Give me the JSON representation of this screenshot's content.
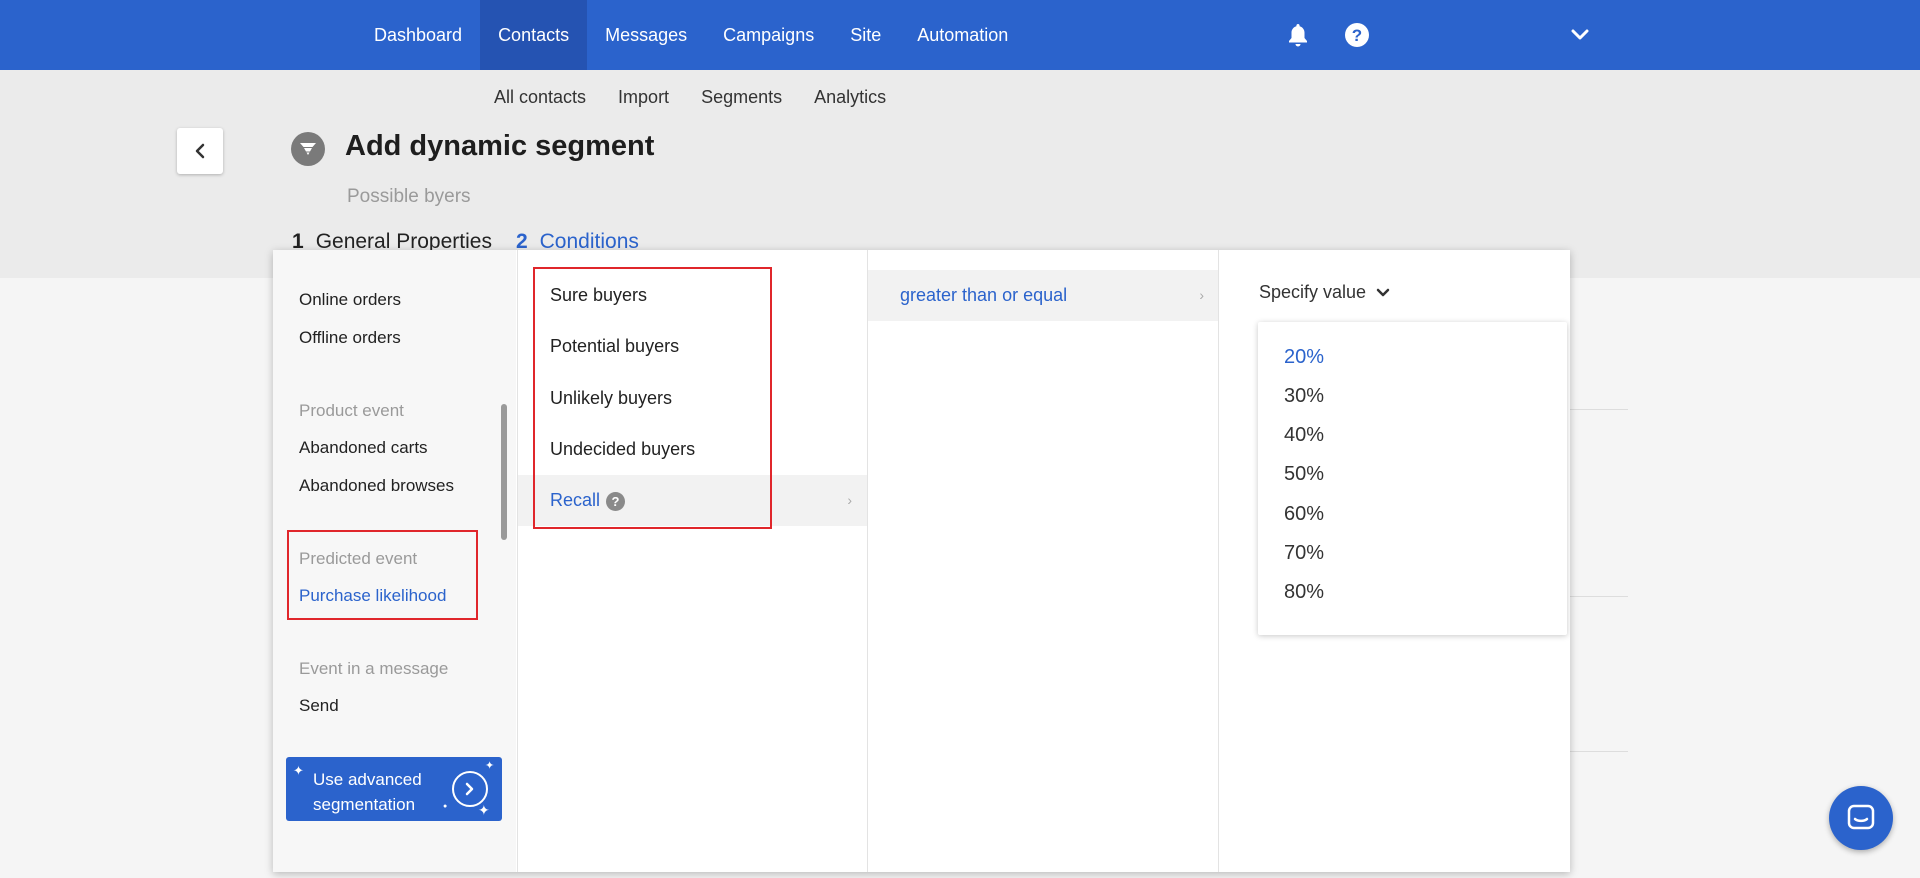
{
  "topnav": {
    "items": [
      "Dashboard",
      "Contacts",
      "Messages",
      "Campaigns",
      "Site",
      "Automation"
    ],
    "active": "Contacts"
  },
  "subnav": {
    "items": [
      "All contacts",
      "Import",
      "Segments",
      "Analytics"
    ]
  },
  "header": {
    "title": "Add dynamic segment",
    "subtitle": "Possible byers",
    "steps": [
      {
        "num": "1",
        "label": "General Properties"
      },
      {
        "num": "2",
        "label": "Conditions"
      }
    ]
  },
  "menu": {
    "col1": {
      "items_top": [
        "Online orders",
        "Offline orders"
      ],
      "group_product": "Product event",
      "items_product": [
        "Abandoned carts",
        "Abandoned browses"
      ],
      "group_predicted": "Predicted event",
      "item_predicted": "Purchase likelihood",
      "group_message": "Event in a message",
      "item_message": "Send",
      "cta": "Use advanced segmentation"
    },
    "col2": {
      "items": [
        "Sure buyers",
        "Potential buyers",
        "Unlikely buyers",
        "Undecided buyers",
        "Recall"
      ],
      "active": "Recall"
    },
    "col3": {
      "operator": "greater than or equal"
    },
    "col4": {
      "placeholder": "Specify value",
      "options": [
        "20%",
        "30%",
        "40%",
        "50%",
        "60%",
        "70%",
        "80%"
      ],
      "highlighted": "20%"
    }
  },
  "colors": {
    "brand": "#2b63cc",
    "annotation": "#e0262b"
  }
}
